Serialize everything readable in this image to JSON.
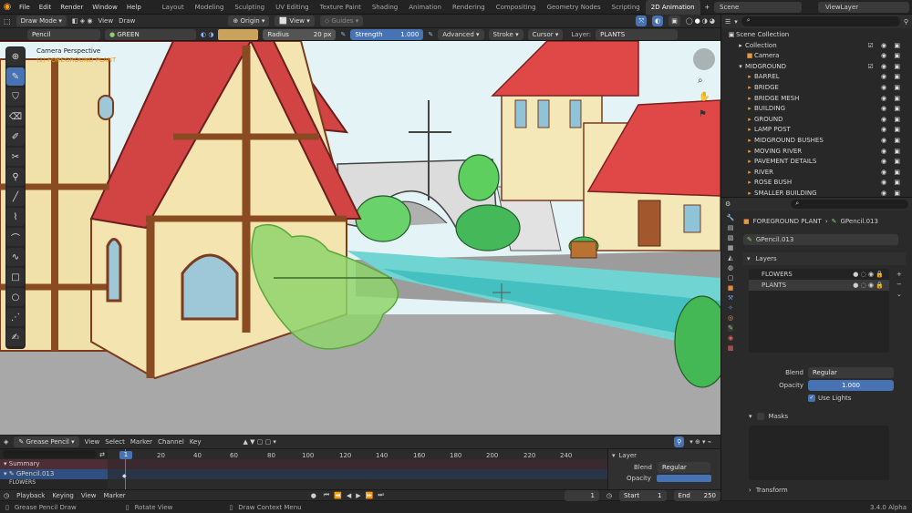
{
  "menubar": {
    "menus": [
      "File",
      "Edit",
      "Render",
      "Window",
      "Help"
    ],
    "workspaces": [
      "Layout",
      "Modeling",
      "Sculpting",
      "UV Editing",
      "Texture Paint",
      "Shading",
      "Animation",
      "Rendering",
      "Compositing",
      "Geometry Nodes",
      "Scripting",
      "2D Animation"
    ],
    "active_workspace": "2D Animation",
    "add_tab": "+",
    "scene": "Scene",
    "view_layer": "ViewLayer"
  },
  "viewport_header": {
    "mode": "Draw Mode",
    "menu_view": "View",
    "menu_draw": "Draw",
    "origin": "Origin",
    "view": "View",
    "guides": "Guides"
  },
  "tool_settings": {
    "brush": "Pencil",
    "material": "GREEN",
    "radius_label": "Radius",
    "radius_value": "20 px",
    "strength_label": "Strength",
    "strength_value": "1.000",
    "advanced": "Advanced",
    "stroke": "Stroke",
    "cursor": "Cursor",
    "layer_label": "Layer:",
    "layer_value": "PLANTS",
    "color": "#c9a35c"
  },
  "viewport": {
    "info_line1": "Camera Perspective",
    "info_line2": "(1) FOREGROUND PLANT"
  },
  "outliner": {
    "search_placeholder": "",
    "scene_collection": "Scene Collection",
    "collection": "Collection",
    "camera": "Camera",
    "midground": "MIDGROUND",
    "items": [
      "BARREL",
      "BRIDGE",
      "BRIDGE MESH",
      "BUILDING",
      "GROUND",
      "LAMP POST",
      "MIDGROUND BUSHES",
      "MOVING RIVER",
      "PAVEMENT DETAILS",
      "RIVER",
      "ROSE BUSH",
      "SMALLER BUILDING"
    ]
  },
  "properties": {
    "object": "FOREGROUND PLANT",
    "data": "GPencil.013",
    "datablock": "GPencil.013",
    "layers_title": "Layers",
    "layers": [
      "FLOWERS",
      "PLANTS"
    ],
    "active_layer": "PLANTS",
    "blend_label": "Blend",
    "blend_value": "Regular",
    "opacity_label": "Opacity",
    "opacity_value": "1.000",
    "use_lights": "Use Lights",
    "masks": "Masks",
    "transform": "Transform"
  },
  "dopesheet": {
    "mode": "Grease Pencil",
    "menus": [
      "View",
      "Select",
      "Marker",
      "Channel",
      "Key"
    ],
    "current_frame": "1",
    "ticks": [
      "20",
      "40",
      "60",
      "80",
      "100",
      "120",
      "140",
      "160",
      "180",
      "200",
      "220",
      "240"
    ],
    "channels": [
      "Summary",
      "GPencil.013",
      "FLOWERS"
    ],
    "sidebar_title": "Layer",
    "sidebar_blend_label": "Blend",
    "sidebar_blend_value": "Regular",
    "sidebar_opacity_label": "Opacity"
  },
  "timeline": {
    "menus": [
      "Playback",
      "Keying",
      "View",
      "Marker"
    ],
    "frame": "1",
    "start_label": "Start",
    "start_value": "1",
    "end_label": "End",
    "end_value": "250"
  },
  "statusbar": {
    "left": "Grease Pencil Draw",
    "mid": "Rotate View",
    "right": "Draw Context Menu",
    "version": "3.4.0 Alpha"
  }
}
